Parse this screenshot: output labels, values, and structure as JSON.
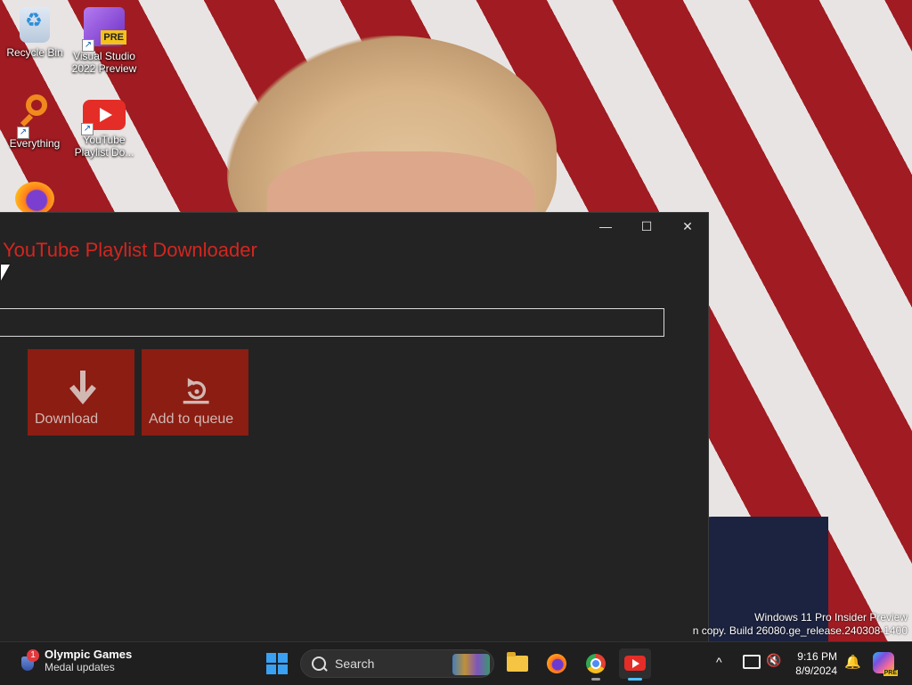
{
  "desktop": {
    "icons": [
      {
        "label": "Recycle Bin"
      },
      {
        "label": "Visual Studio 2022 Preview",
        "badge": "PRE"
      },
      {
        "label": "Everything"
      },
      {
        "label": "YouTube Playlist Do..."
      },
      {
        "label": ""
      }
    ],
    "watermark": {
      "line1": "Windows 11 Pro Insider Preview",
      "line2": "n copy. Build 26080.ge_release.240308-1400"
    }
  },
  "window": {
    "title": "YouTube Playlist Downloader",
    "controls": {
      "minimize": "—",
      "maximize": "☐",
      "close": "✕"
    },
    "url_input": {
      "value": "",
      "placeholder": ""
    },
    "buttons": {
      "download": "Download",
      "add_to_queue": "Add to queue"
    },
    "accent_color": "#d3261f",
    "tile_color": "#8b1d12"
  },
  "taskbar": {
    "widget": {
      "title": "Olympic Games",
      "subtitle": "Medal updates",
      "badge": "1"
    },
    "search_label": "Search",
    "pinned_apps": [
      "file-explorer-icon",
      "firefox-icon",
      "chrome-icon",
      "youtube-playlist-downloader-icon"
    ],
    "clock": {
      "time": "9:16 PM",
      "date": "8/9/2024"
    },
    "chevron": "^",
    "volume": "🔇",
    "bell": "🔔",
    "copilot_badge": "PRE"
  }
}
